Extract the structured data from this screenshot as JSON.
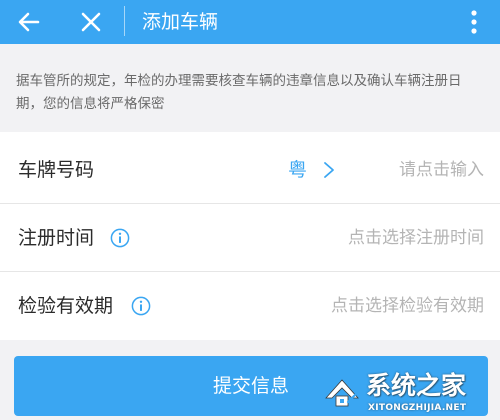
{
  "header": {
    "title": "添加车辆",
    "back_icon": "arrow-left-icon",
    "close_icon": "close-icon",
    "more_icon": "more-vertical-icon"
  },
  "notice": {
    "text": "据车管所的规定，年检的办理需要核查车辆的违章信息以及确认车辆注册日期，您的信息将严格保密"
  },
  "form": {
    "plate": {
      "label": "车牌号码",
      "province": "粤",
      "placeholder": "请点击输入"
    },
    "register_date": {
      "label": "注册时间",
      "info_icon": "info-icon",
      "placeholder": "点击选择注册时间"
    },
    "inspection_validity": {
      "label": "检验有效期",
      "info_icon": "info-icon",
      "placeholder": "点击选择检验有效期"
    }
  },
  "submit": {
    "label": "提交信息"
  },
  "watermark": {
    "name": "系统之家",
    "url": "XITONGZHIJIA.NET"
  },
  "colors": {
    "primary": "#3aa6f2",
    "background": "#f2f2f4",
    "card": "#ffffff",
    "label_text": "#2b2b2b",
    "placeholder_text": "#b4b4b4",
    "notice_text": "#6a6a6a"
  }
}
